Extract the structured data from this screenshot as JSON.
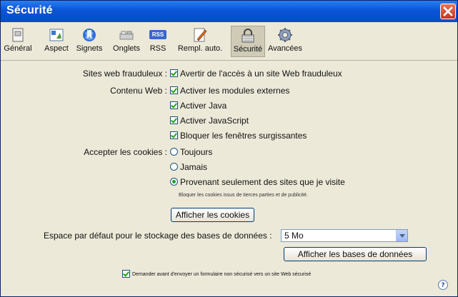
{
  "window": {
    "title": "Sécurité"
  },
  "toolbar": [
    {
      "label": "Général",
      "icon": "general-icon"
    },
    {
      "label": "Aspect",
      "icon": "aspect-icon"
    },
    {
      "label": "Signets",
      "icon": "bookmarks-icon"
    },
    {
      "label": "Onglets",
      "icon": "tabs-icon"
    },
    {
      "label": "RSS",
      "icon": "rss-icon",
      "badge": "RSS"
    },
    {
      "label": "Rempl. auto.",
      "icon": "autofill-icon"
    },
    {
      "label": "Sécurité",
      "icon": "lock-icon",
      "active": true
    },
    {
      "label": "Avancées",
      "icon": "gear-icon"
    }
  ],
  "fraud": {
    "label": "Sites web frauduleux :",
    "checkbox": "Avertir de l'accès à un site Web frauduleux",
    "checked": true
  },
  "web": {
    "label": "Contenu Web :",
    "items": [
      {
        "text": "Activer les modules externes",
        "checked": true
      },
      {
        "text": "Activer Java",
        "checked": true
      },
      {
        "text": "Activer JavaScript",
        "checked": true
      },
      {
        "text": "Bloquer les fenêtres surgissantes",
        "checked": true
      }
    ]
  },
  "cookies": {
    "label": "Accepter les cookies :",
    "options": [
      {
        "text": "Toujours",
        "selected": false
      },
      {
        "text": "Jamais",
        "selected": false
      },
      {
        "text": "Provenant seulement des sites que je visite",
        "selected": true
      }
    ],
    "note": "Bloquer les cookies issus de tierces parties et de publicité.",
    "show_button": "Afficher les cookies"
  },
  "database": {
    "label": "Espace par défaut pour le stockage des bases de données :",
    "value": "5 Mo",
    "show_button": "Afficher les bases de données"
  },
  "footer": {
    "checkbox": "Demander avant d'envoyer un formulaire non sécurisé vers un site Web sécurisé",
    "checked": true
  },
  "help": {
    "glyph": "?"
  }
}
